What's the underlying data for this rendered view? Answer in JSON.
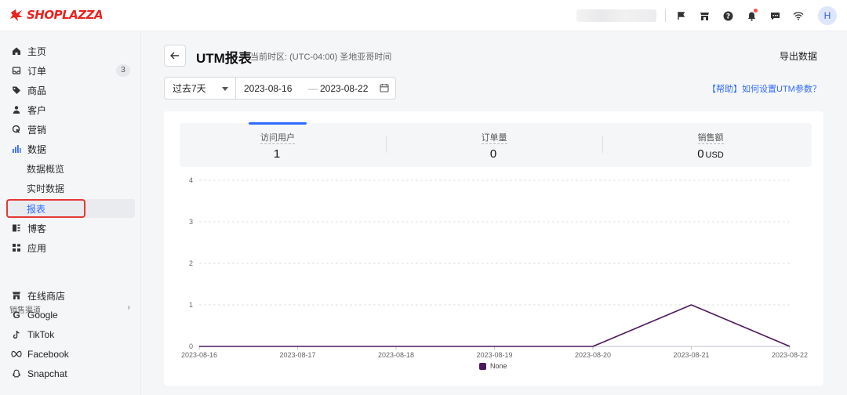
{
  "brand": {
    "logo_text": "SHOPLAZZA"
  },
  "topbar": {
    "avatar_initial": "H",
    "icons": [
      "flag-icon",
      "store-icon",
      "help-icon",
      "bell-icon",
      "chat-icon",
      "wifi-icon"
    ]
  },
  "sidebar": {
    "items": [
      {
        "label": "主页",
        "icon": "home-icon"
      },
      {
        "label": "订单",
        "icon": "orders-icon",
        "badge": "3"
      },
      {
        "label": "商品",
        "icon": "tag-icon"
      },
      {
        "label": "客户",
        "icon": "person-icon"
      },
      {
        "label": "营销",
        "icon": "marketing-icon"
      },
      {
        "label": "数据",
        "icon": "bar-chart-icon"
      },
      {
        "label": "数据概览"
      },
      {
        "label": "实时数据"
      },
      {
        "label": "报表"
      },
      {
        "label": "博客",
        "icon": "blog-icon"
      },
      {
        "label": "应用",
        "icon": "apps-icon"
      }
    ],
    "channels_title": "销售渠道",
    "channels": [
      {
        "label": "在线商店",
        "icon": "store-icon"
      },
      {
        "label": "Google",
        "icon": "google-icon"
      },
      {
        "label": "TikTok",
        "icon": "tiktok-icon"
      },
      {
        "label": "Facebook",
        "icon": "facebook-icon"
      },
      {
        "label": "Snapchat",
        "icon": "snapchat-icon"
      }
    ]
  },
  "header": {
    "title": "UTM报表",
    "timezone": "当前时区: (UTC-04:00) 圣地亚哥时间",
    "export_label": "导出数据"
  },
  "filters": {
    "range_label": "过去7天",
    "start_date": "2023-08-16",
    "separator": "—",
    "end_date": "2023-08-22",
    "help_link": "【帮助】如何设置UTM参数？"
  },
  "metrics": [
    {
      "label": "访问用户",
      "value": "1",
      "unit": ""
    },
    {
      "label": "订单量",
      "value": "0",
      "unit": ""
    },
    {
      "label": "销售额",
      "value": "0",
      "unit": "USD"
    }
  ],
  "colors": {
    "accent": "#2f6bff",
    "series": "#4b1a5e",
    "brand": "#e8231f"
  },
  "chart_data": {
    "type": "line",
    "x": [
      "2023-08-16",
      "2023-08-17",
      "2023-08-18",
      "2023-08-19",
      "2023-08-20",
      "2023-08-21",
      "2023-08-22"
    ],
    "series": [
      {
        "name": "None",
        "values": [
          0,
          0,
          0,
          0,
          0,
          1,
          0
        ]
      }
    ],
    "yticks": [
      "0",
      "1",
      "2",
      "3",
      "4"
    ],
    "ylim": [
      0,
      4
    ],
    "grid": true,
    "legend": "bottom"
  }
}
